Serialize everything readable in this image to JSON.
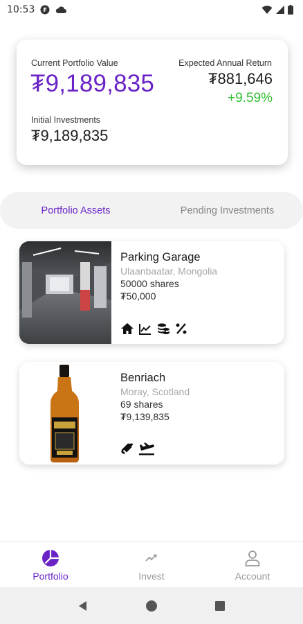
{
  "status_bar": {
    "time": "10:53"
  },
  "summary": {
    "current_value_label": "Current Portfolio Value",
    "current_value": "₮9,189,835",
    "expected_return_label": "Expected Annual Return",
    "expected_return_value": "₮881,646",
    "expected_return_pct": "+9.59%",
    "initial_label": "Initial Investments",
    "initial_value": "₮9,189,835"
  },
  "tabs": [
    {
      "label": "Portfolio Assets",
      "active": true
    },
    {
      "label": "Pending Investments",
      "active": false
    }
  ],
  "assets": [
    {
      "name": "Parking Garage",
      "location": "Ulaanbaatar, Mongolia",
      "shares": "50000 shares",
      "value": "₮50,000",
      "icons": [
        "home-icon",
        "chart-line-icon",
        "coins-icon",
        "percent-icon"
      ]
    },
    {
      "name": "Benriach",
      "location": "Moray, Scotland",
      "shares": "69 shares",
      "value": "₮9,139,835",
      "icons": [
        "bottle-icon",
        "plane-landing-icon"
      ]
    }
  ],
  "bottom_nav": [
    {
      "label": "Portfolio",
      "icon": "pie-chart-icon",
      "active": true
    },
    {
      "label": "Invest",
      "icon": "trend-icon",
      "active": false
    },
    {
      "label": "Account",
      "icon": "user-icon",
      "active": false
    }
  ],
  "colors": {
    "accent": "#6a24c6",
    "positive": "#2fbf2f",
    "muted": "#a6a6a6"
  }
}
